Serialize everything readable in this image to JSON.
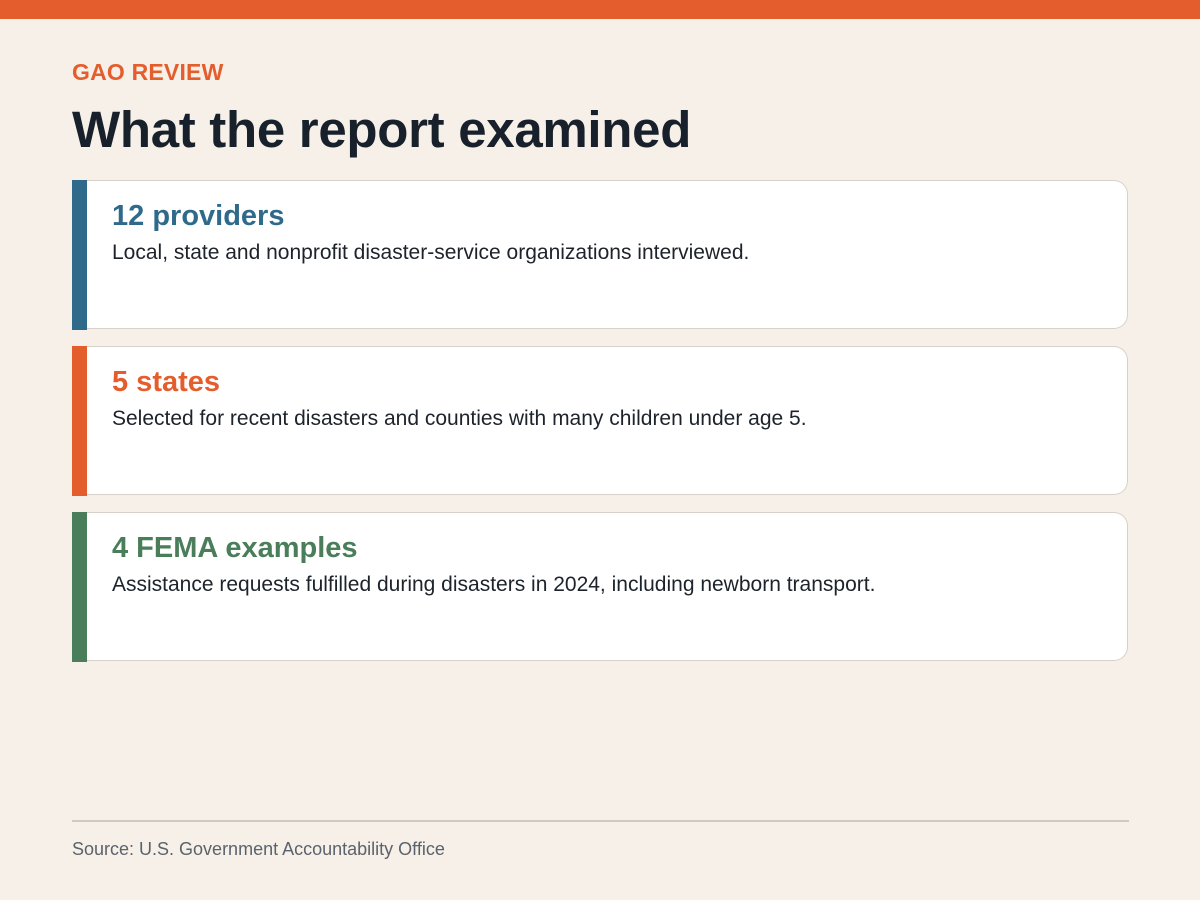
{
  "header": {
    "eyebrow": "GAO REVIEW",
    "title": "What the report examined"
  },
  "cards": [
    {
      "headline": "12 providers",
      "description": "Local, state and nonprofit disaster-service organizations interviewed.",
      "accent_color": "#2f6a8a"
    },
    {
      "headline": "5 states",
      "description": "Selected for recent disasters and counties with many children under age 5.",
      "accent_color": "#e45e2d"
    },
    {
      "headline": "4 FEMA examples",
      "description": "Assistance requests fulfilled during disasters in 2024, including newborn transport.",
      "accent_color": "#4a7d5a"
    }
  ],
  "footer": {
    "source": "Source: U.S. Government Accountability Office"
  },
  "colors": {
    "background": "#f6f0e9",
    "top_bar": "#e45e2d",
    "title": "#17202b"
  }
}
